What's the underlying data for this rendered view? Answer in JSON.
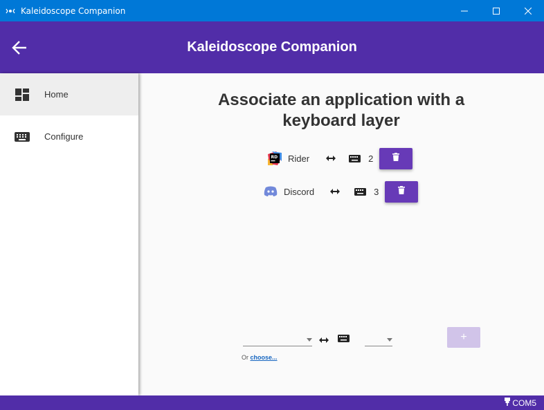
{
  "window": {
    "title": "Kaleidoscope Companion",
    "app_icon": "kaleidoscope-icon"
  },
  "appbar": {
    "title": "Kaleidoscope Companion",
    "back_icon": "arrow-back-icon"
  },
  "sidebar": {
    "items": [
      {
        "label": "Home",
        "icon": "dashboard-icon",
        "active": true
      },
      {
        "label": "Configure",
        "icon": "keyboard-icon",
        "active": false
      }
    ]
  },
  "main": {
    "heading": "Associate an application with a keyboard layer",
    "associations": [
      {
        "app": "Rider",
        "icon": "rider-icon",
        "layer": "2"
      },
      {
        "app": "Discord",
        "icon": "discord-icon",
        "layer": "3"
      }
    ],
    "add_form": {
      "app_value": "",
      "layer_value": "",
      "add_label": "+",
      "or_text": "Or",
      "choose_link": "choose..."
    }
  },
  "status": {
    "port": "COM5",
    "port_icon": "usb-plug-icon"
  },
  "colors": {
    "primary": "#512da8",
    "accent": "#673ab7",
    "titlebar": "#0078d7"
  }
}
